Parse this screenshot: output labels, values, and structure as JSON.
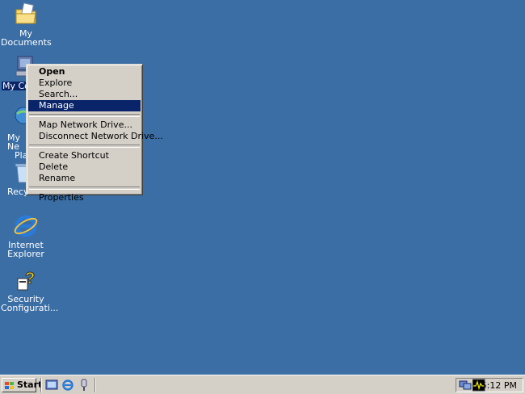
{
  "desktop": {
    "icons": [
      {
        "label": "My Documents"
      },
      {
        "label": "My Co",
        "selected": true
      },
      {
        "label_line1": "My Ne",
        "label_line2": "Pla"
      },
      {
        "label": "Recyc"
      },
      {
        "label_line1": "Internet",
        "label_line2": "Explorer"
      },
      {
        "label_line1": "Security",
        "label_line2": "Configurati..."
      }
    ]
  },
  "context_menu": {
    "items": [
      {
        "label": "Open"
      },
      {
        "label": "Explore"
      },
      {
        "label": "Search..."
      },
      {
        "label": "Manage"
      },
      {
        "label": "Map Network Drive..."
      },
      {
        "label": "Disconnect Network Drive..."
      },
      {
        "label": "Create Shortcut"
      },
      {
        "label": "Delete"
      },
      {
        "label": "Rename"
      },
      {
        "label": "Properties"
      }
    ],
    "highlight_color": "#0a246a"
  },
  "taskbar": {
    "start_label": "Start",
    "clock": "5:12 PM"
  },
  "colors": {
    "desktop": "#3a6ea5",
    "chrome": "#d4d0c8"
  }
}
